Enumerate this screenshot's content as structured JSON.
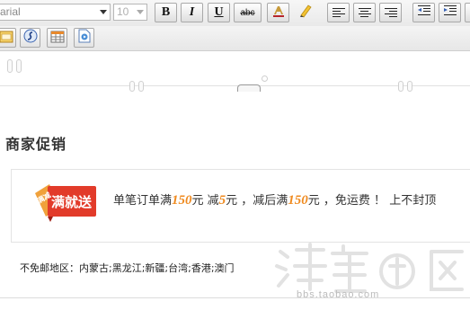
{
  "toolbar": {
    "font_family": "arial",
    "font_size": "10",
    "bold_label": "B",
    "italic_label": "I",
    "underline_label": "U",
    "strike_label": "abc"
  },
  "content": {
    "heading": "商家促销",
    "badge_small": "满减",
    "badge_main": "满就送",
    "promo": {
      "p1": "单笔订单满",
      "n1": "150",
      "p2": "元 减",
      "n2": "5",
      "p3": "元 ，减后满",
      "n3": "150",
      "p4": "元 ，免运费 ！ 上不封顶"
    },
    "excluded": "不免邮地区：内蒙古;黑龙江;新疆;台湾;香港;澳门"
  },
  "watermark": {
    "logo": "淘宝社区",
    "url": "bbs.taobao.com"
  },
  "colors": {
    "accent_orange": "#ef8a1f",
    "badge_red": "#e23b2a"
  },
  "icons": [
    "text-color-icon",
    "highlight-icon",
    "align-left-icon",
    "align-center-icon",
    "align-right-icon",
    "outdent-icon",
    "indent-icon",
    "image-icon",
    "flash-icon",
    "table-icon",
    "media-icon"
  ]
}
